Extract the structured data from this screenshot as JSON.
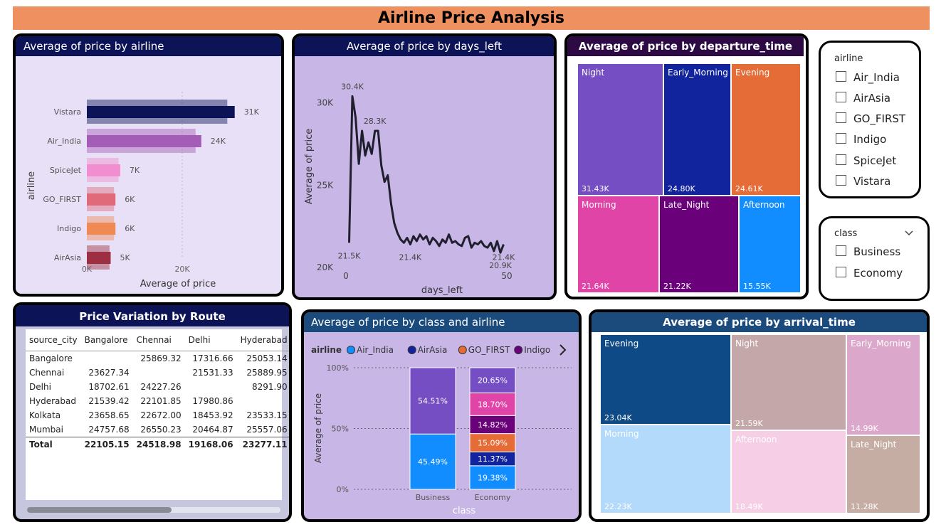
{
  "title": "Airline Price Analysis",
  "panels": {
    "airline_chart": "Average of price by airline",
    "days_chart": "Average of price by days_left",
    "departure_chart": "Average of price by departure_time",
    "route_table": "Price Variation by Route",
    "class_chart": "Average of price by class and airline",
    "arrival_chart": "Average of price by arrival_time"
  },
  "slicers": {
    "airline": {
      "title": "airline",
      "options": [
        "Air_India",
        "AirAsia",
        "GO_FIRST",
        "Indigo",
        "SpiceJet",
        "Vistara"
      ]
    },
    "class": {
      "title": "class",
      "options": [
        "Business",
        "Economy"
      ],
      "chevron_icon": "chevron-down-icon"
    }
  },
  "route_table": {
    "columns": [
      "source_city",
      "Bangalore",
      "Chennai",
      "Delhi",
      "Hyderabad"
    ],
    "rows": [
      [
        "Bangalore",
        "",
        "25869.32",
        "17316.66",
        "25053.14"
      ],
      [
        "Chennai",
        "23627.34",
        "",
        "21531.33",
        "25889.95"
      ],
      [
        "Delhi",
        "18702.61",
        "24227.26",
        "",
        "8291.90"
      ],
      [
        "Hyderabad",
        "21539.42",
        "22101.85",
        "17980.86",
        ""
      ],
      [
        "Kolkata",
        "23658.65",
        "22672.00",
        "18453.92",
        "23533.15"
      ],
      [
        "Mumbai",
        "24757.68",
        "26550.23",
        "20464.87",
        "25557.06"
      ]
    ],
    "total": [
      "Total",
      "22105.15",
      "24518.98",
      "19168.06",
      "23277.11"
    ],
    "scroll_fraction": 0.57
  },
  "chart_data": [
    {
      "type": "bar",
      "orientation": "horizontal",
      "categories": [
        "Vistara",
        "Air_India",
        "SpiceJet",
        "GO_FIRST",
        "Indigo",
        "AirAsia"
      ],
      "values": [
        31000,
        24000,
        7000,
        6000,
        6000,
        5000
      ],
      "value_labels": [
        "31K",
        "24K",
        "7K",
        "6K",
        "6K",
        "5K"
      ],
      "colors": [
        "#0c1356",
        "#a35db7",
        "#f08ecf",
        "#e06a7a",
        "#f08a55",
        "#9e2f43"
      ],
      "xlabel": "Average of price",
      "ylabel": "airline",
      "xticks": [
        "0K",
        "20K"
      ],
      "xlim": [
        0,
        40000
      ]
    },
    {
      "type": "line",
      "x": [
        1,
        2,
        3,
        4,
        5,
        6,
        7,
        8,
        9,
        10,
        11,
        12,
        13,
        14,
        15,
        16,
        17,
        18,
        19,
        20,
        21,
        22,
        23,
        24,
        25,
        26,
        27,
        28,
        29,
        30,
        31,
        32,
        33,
        34,
        35,
        36,
        37,
        38,
        39,
        40,
        41,
        42,
        43,
        44,
        45,
        46,
        47,
        48,
        49
      ],
      "y": [
        21500,
        30400,
        29100,
        26300,
        28300,
        26800,
        27600,
        26900,
        28300,
        28300,
        26200,
        25200,
        25600,
        23900,
        22700,
        22100,
        21700,
        21500,
        21800,
        21400,
        21900,
        21600,
        22000,
        21700,
        21900,
        21400,
        21800,
        21600,
        21300,
        21700,
        21500,
        22000,
        21500,
        21600,
        21400,
        21300,
        21800,
        21900,
        21200,
        21500,
        21400,
        21600,
        21300,
        21200,
        21500,
        21000,
        21600,
        20900,
        21400
      ],
      "point_labels": [
        {
          "x": 1,
          "text": "21.5K"
        },
        {
          "x": 2,
          "text": "30.4K"
        },
        {
          "x": 9,
          "text": "28.3K"
        },
        {
          "x": 20,
          "text": "21.4K"
        },
        {
          "x": 48,
          "text": "20.9K"
        },
        {
          "x": 49,
          "text": "21.4K"
        }
      ],
      "xlabel": "days_left",
      "ylabel": "Average of price",
      "yticks": [
        {
          "v": 20000,
          "t": "20K"
        },
        {
          "v": 25000,
          "t": "25K"
        },
        {
          "v": 30000,
          "t": "30K"
        }
      ],
      "xticks": [
        {
          "v": 0,
          "t": "0"
        },
        {
          "v": 50,
          "t": "50"
        }
      ],
      "xlim": [
        0,
        50
      ],
      "ylim": [
        20000,
        31500
      ],
      "color": "#1f1f2e"
    },
    {
      "type": "bar",
      "stacked": "100%",
      "categories": [
        "Business",
        "Economy"
      ],
      "legend_title": "airline",
      "legend": [
        {
          "name": "Air_India",
          "color": "#118dff"
        },
        {
          "name": "AirAsia",
          "color": "#12239e"
        },
        {
          "name": "GO_FIRST",
          "color": "#e66c37"
        },
        {
          "name": "Indigo",
          "color": "#6b007b"
        }
      ],
      "stacks": [
        [
          {
            "value": 45.49,
            "label": "45.49%",
            "color": "#118dff"
          },
          {
            "value": 54.51,
            "label": "54.51%",
            "color": "#744ec2"
          }
        ],
        [
          {
            "value": 19.38,
            "label": "19.38%",
            "color": "#118dff"
          },
          {
            "value": 11.37,
            "label": "11.37%",
            "color": "#12239e"
          },
          {
            "value": 15.09,
            "label": "15.09%",
            "color": "#e66c37"
          },
          {
            "value": 14.82,
            "label": "14.82%",
            "color": "#6b007b"
          },
          {
            "value": 18.7,
            "label": "18.70%",
            "color": "#e044a7"
          },
          {
            "value": 20.65,
            "label": "20.65%",
            "color": "#744ec2"
          }
        ]
      ],
      "yticks": [
        "0%",
        "50%",
        "100%"
      ],
      "xlabel": "class",
      "ylabel": "Average of price"
    },
    {
      "type": "treemap",
      "items": [
        {
          "name": "Night",
          "value": "31.43K",
          "color": "#744ec2"
        },
        {
          "name": "Early_Morning",
          "value": "24.80K",
          "color": "#12239e"
        },
        {
          "name": "Evening",
          "value": "24.61K",
          "color": "#e66c37"
        },
        {
          "name": "Morning",
          "value": "21.64K",
          "color": "#e044a7"
        },
        {
          "name": "Late_Night",
          "value": "21.22K",
          "color": "#6b007b"
        },
        {
          "name": "Afternoon",
          "value": "15.55K",
          "color": "#118dff"
        }
      ]
    },
    {
      "type": "treemap",
      "items": [
        {
          "name": "Evening",
          "value": "23.04K",
          "color": "#0e4a85"
        },
        {
          "name": "Night",
          "value": "21.59K",
          "color": "#c4a7a9"
        },
        {
          "name": "Early_Morning",
          "value": "14.99K",
          "color": "#dba8cc"
        },
        {
          "name": "Morning",
          "value": "22.23K",
          "color": "#b4dafb"
        },
        {
          "name": "Afternoon",
          "value": "18.49K",
          "color": "#f6cfe7"
        },
        {
          "name": "Late_Night",
          "value": "11.28K",
          "color": "#c6ada3"
        }
      ]
    }
  ]
}
